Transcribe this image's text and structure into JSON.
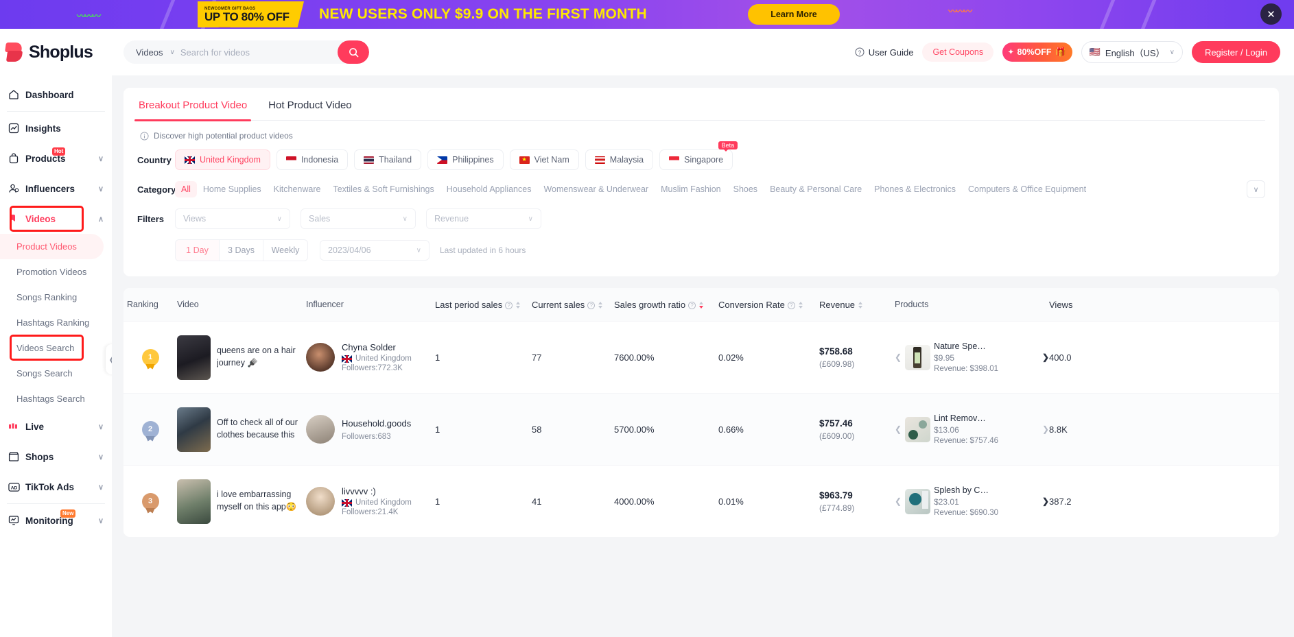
{
  "promo": {
    "gift_small": "NEWCOMER GIFT BAGS",
    "gift_big": "UP TO 80% OFF",
    "headline": "NEW USERS ONLY $9.9 ON  THE FIRST MONTH",
    "learn_more": "Learn More",
    "close": "✕"
  },
  "topbar": {
    "logo": "Shoplus",
    "search_category": "Videos",
    "search_placeholder": "Search for videos",
    "search_value": "",
    "user_guide": "User Guide",
    "get_coupons": "Get Coupons",
    "off_badge": "80%OFF",
    "language": "English（US）",
    "register": "Register / Login"
  },
  "sidebar": {
    "items": [
      {
        "label": "Dashboard",
        "icon": "home-icon",
        "expandable": false
      },
      {
        "label": "Insights",
        "icon": "chart-icon",
        "expandable": false
      },
      {
        "label": "Products",
        "icon": "bag-icon",
        "expandable": true,
        "badge": "Hot"
      },
      {
        "label": "Influencers",
        "icon": "user-icon",
        "expandable": true
      },
      {
        "label": "Videos",
        "icon": "video-icon",
        "expandable": true,
        "active": true
      },
      {
        "label": "Live",
        "icon": "live-icon",
        "expandable": true
      },
      {
        "label": "Shops",
        "icon": "shop-icon",
        "expandable": true
      },
      {
        "label": "TikTok Ads",
        "icon": "ad-icon",
        "expandable": true
      },
      {
        "label": "Monitoring",
        "icon": "monitor-icon",
        "expandable": true,
        "badge": "New"
      }
    ],
    "video_subitems": [
      {
        "label": "Product Videos",
        "current": true
      },
      {
        "label": "Promotion Videos"
      },
      {
        "label": "Songs Ranking"
      },
      {
        "label": "Hashtags Ranking"
      },
      {
        "label": "Videos Search",
        "highlighted": true
      },
      {
        "label": "Songs Search"
      },
      {
        "label": "Hashtags Search"
      }
    ]
  },
  "main": {
    "tabs": [
      {
        "label": "Breakout Product Video",
        "selected": true
      },
      {
        "label": "Hot Product Video",
        "selected": false
      }
    ],
    "hint": "Discover high potential product videos",
    "country_label": "Country",
    "countries": [
      {
        "label": "United Kingdom",
        "selected": true
      },
      {
        "label": "Indonesia",
        "selected": false
      },
      {
        "label": "Thailand",
        "selected": false
      },
      {
        "label": "Philippines",
        "selected": false
      },
      {
        "label": "Viet Nam",
        "selected": false
      },
      {
        "label": "Malaysia",
        "selected": false
      },
      {
        "label": "Singapore",
        "selected": false,
        "badge": "Beta"
      }
    ],
    "category_label": "Category",
    "categories": [
      {
        "label": "All",
        "selected": true
      },
      {
        "label": "Home Supplies"
      },
      {
        "label": "Kitchenware"
      },
      {
        "label": "Textiles & Soft Furnishings"
      },
      {
        "label": "Household Appliances"
      },
      {
        "label": "Womenswear & Underwear"
      },
      {
        "label": "Muslim Fashion"
      },
      {
        "label": "Shoes"
      },
      {
        "label": "Beauty & Personal Care"
      },
      {
        "label": "Phones & Electronics"
      },
      {
        "label": "Computers & Office Equipment"
      }
    ],
    "filters_label": "Filters",
    "filters": [
      {
        "placeholder": "Views"
      },
      {
        "placeholder": "Sales"
      },
      {
        "placeholder": "Revenue"
      }
    ],
    "ranges": [
      {
        "label": "1 Day",
        "selected": true
      },
      {
        "label": "3 Days",
        "selected": false
      },
      {
        "label": "Weekly",
        "selected": false
      }
    ],
    "date_value": "2023/04/06",
    "last_updated": "Last updated in 6 hours"
  },
  "table": {
    "columns": [
      {
        "key": "ranking",
        "label": "Ranking",
        "sortable": false,
        "info": false
      },
      {
        "key": "video",
        "label": "Video",
        "sortable": false,
        "info": false
      },
      {
        "key": "influencer",
        "label": "Influencer",
        "sortable": false,
        "info": false
      },
      {
        "key": "last_period_sales",
        "label": "Last period sales",
        "sortable": true,
        "info": true
      },
      {
        "key": "current_sales",
        "label": "Current sales",
        "sortable": true,
        "info": true
      },
      {
        "key": "sales_growth_ratio",
        "label": "Sales growth ratio",
        "sortable": true,
        "info": true,
        "sort_active": "desc"
      },
      {
        "key": "conversion_rate",
        "label": "Conversion Rate",
        "sortable": true,
        "info": true
      },
      {
        "key": "revenue",
        "label": "Revenue",
        "sortable": true,
        "info": false
      },
      {
        "key": "products",
        "label": "Products",
        "sortable": false,
        "info": false
      },
      {
        "key": "views",
        "label": "Views",
        "sortable": false,
        "info": false
      }
    ],
    "rows": [
      {
        "rank": "1",
        "rank_medal": "gold",
        "video_title": "queens are on a hair journey 🪮 #rosemary…",
        "influencer_name": "Chyna Solder",
        "influencer_country": "United Kingdom",
        "influencer_followers": "Followers:772.3K",
        "last_period_sales": "1",
        "current_sales": "77",
        "sales_growth_ratio": "7600.00%",
        "conversion_rate": "0.02%",
        "revenue_usd": "$758.68",
        "revenue_local": "(£609.98)",
        "product_name": "Nature Spe…",
        "product_price": "$9.95",
        "product_revenue": "Revenue: $398.01",
        "views": "400.0"
      },
      {
        "rank": "2",
        "rank_medal": "silver",
        "video_title": "Off to check all of our clothes because this w…",
        "influencer_name": "Household.goods",
        "influencer_country": "",
        "influencer_followers": "Followers:683",
        "last_period_sales": "1",
        "current_sales": "58",
        "sales_growth_ratio": "5700.00%",
        "conversion_rate": "0.66%",
        "revenue_usd": "$757.46",
        "revenue_local": "(£609.00)",
        "product_name": "Lint Remov…",
        "product_price": "$13.06",
        "product_revenue": "Revenue: $757.46",
        "views": "8.8K"
      },
      {
        "rank": "3",
        "rank_medal": "bronze",
        "video_title": "i love embarrassing myself on this app😳 #u…",
        "influencer_name": "livvvvv :)",
        "influencer_country": "United Kingdom",
        "influencer_followers": "Followers:21.4K",
        "last_period_sales": "1",
        "current_sales": "41",
        "sales_growth_ratio": "4000.00%",
        "conversion_rate": "0.01%",
        "revenue_usd": "$963.79",
        "revenue_local": "(£774.89)",
        "product_name": "Splesh by C…",
        "product_price": "$23.01",
        "product_revenue": "Revenue: $690.30",
        "views": "387.2"
      }
    ]
  },
  "colors": {
    "accent": "#ff3b5c",
    "promo_yellow": "#ffe900",
    "promo_bg": "#7b3ff0",
    "highlight": "#ff1a1a"
  }
}
